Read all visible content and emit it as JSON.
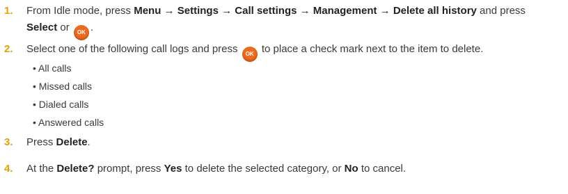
{
  "steps": [
    {
      "number": "1.",
      "line1": {
        "prefix": "From Idle mode, press ",
        "path": [
          "Menu",
          "Settings",
          "Call settings",
          "Management",
          "Delete all history"
        ],
        "arrow": " → ",
        "suffix": " and press"
      },
      "line2": {
        "bold": "Select",
        "mid": " or ",
        "end": "."
      }
    },
    {
      "number": "2.",
      "text_before": "Select one of the following call logs and press ",
      "text_after": " to place a check mark next to the item to delete.",
      "bullets": [
        "All calls",
        "Missed calls",
        "Dialed calls",
        "Answered calls"
      ]
    },
    {
      "number": "3.",
      "prefix": "Press ",
      "bold": "Delete",
      "suffix": "."
    },
    {
      "number": "4.",
      "p1": "At the ",
      "b1": "Delete?",
      "p2": " prompt, press ",
      "b2": "Yes",
      "p3": " to delete the selected category, or ",
      "b3": "No",
      "p4": " to cancel."
    }
  ],
  "ok_key_label": "OK",
  "bullet_char": "•"
}
